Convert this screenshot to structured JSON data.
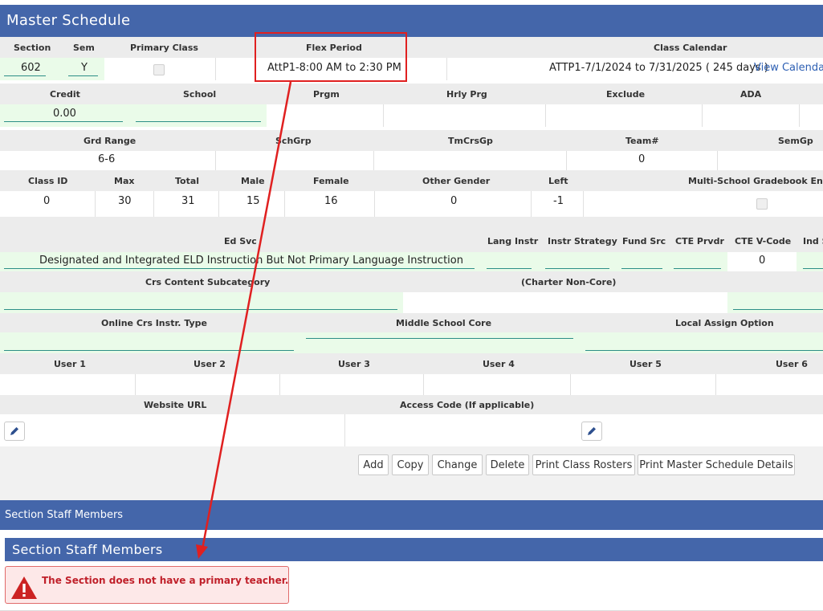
{
  "title": "Master Schedule",
  "row1": {
    "headers": [
      "Section",
      "Sem",
      "Primary Class",
      "Flex Period",
      "Class Calendar"
    ],
    "section": "602",
    "sem": "Y",
    "flex_period": "AttP1-8:00 AM to 2:30 PM",
    "class_calendar": "ATTP1-7/1/2024 to 7/31/2025 ( 245 days )",
    "view_calendar_link": "View Calendar"
  },
  "row2": {
    "headers": [
      "Credit",
      "School",
      "Prgm",
      "Hrly Prg",
      "Exclude",
      "ADA"
    ],
    "credit": "0.00"
  },
  "row3": {
    "headers": [
      "Grd Range",
      "SchGrp",
      "TmCrsGp",
      "Team#",
      "SemGp"
    ],
    "grd_range": "6-6",
    "team": "0"
  },
  "row4": {
    "headers": [
      "Class ID",
      "Max",
      "Total",
      "Male",
      "Female",
      "Other Gender",
      "Left",
      "Multi-School Gradebook Enab"
    ],
    "values": [
      "0",
      "30",
      "31",
      "15",
      "16",
      "0",
      "-1"
    ]
  },
  "row5": {
    "headers": [
      "Ed Svc",
      "Lang Instr",
      "Instr Strategy",
      "Fund Src",
      "CTE Prvdr",
      "CTE V-Code",
      "Ind S"
    ],
    "ed_svc": "Designated and Integrated ELD Instruction But Not Primary Language Instruction",
    "cte_vcode": "0"
  },
  "row6": {
    "headers": [
      "Crs Content Subcategory",
      "(Charter Non-Core)"
    ]
  },
  "row7": {
    "headers": [
      "Online Crs Instr. Type",
      "Middle School Core",
      "Local Assign Option"
    ]
  },
  "row8": {
    "headers": [
      "User 1",
      "User 2",
      "User 3",
      "User 4",
      "User 5",
      "User 6"
    ]
  },
  "row9": {
    "headers": [
      "Website URL",
      "Access Code (If applicable)"
    ]
  },
  "buttons": [
    "Add",
    "Copy",
    "Change",
    "Delete",
    "Print Class Rosters",
    "Print Master Schedule Details"
  ],
  "staff_bar": "Section Staff Members",
  "staff_title": "Section Staff Members",
  "alert": "The Section does not have a primary teacher.",
  "colors": {
    "brand": "#4466aa",
    "highlight": "#e02020",
    "field_green": "#eafbe9",
    "alert_bg": "#fde8e8"
  }
}
